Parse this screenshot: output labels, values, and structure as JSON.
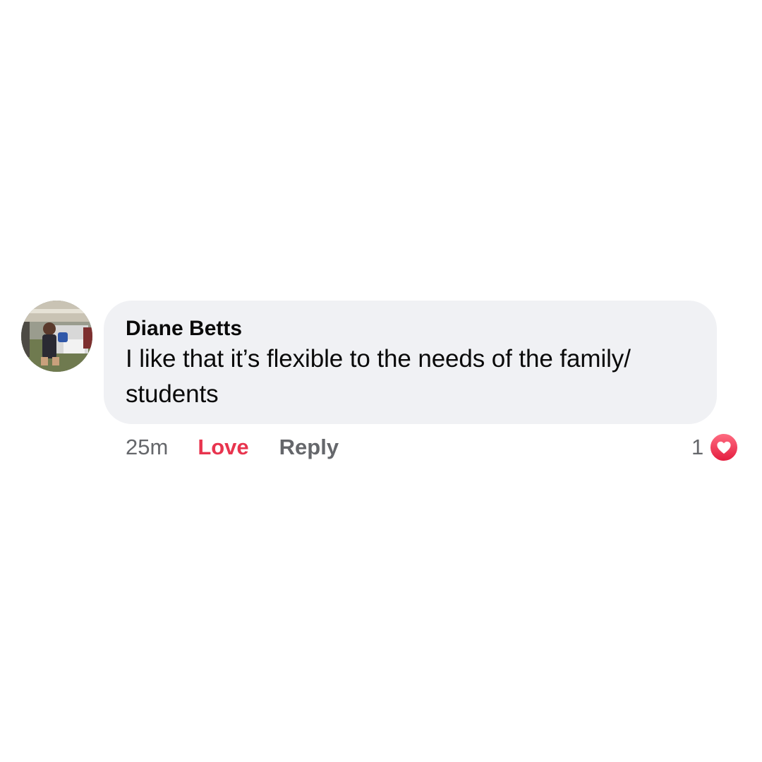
{
  "comment": {
    "author": "Diane Betts",
    "text_line1": "I like that it’s flexible to the needs of the family/",
    "text_line2": "students",
    "timestamp": "25m",
    "love_label": "Love",
    "reply_label": "Reply",
    "reaction_count": "1",
    "reaction_icon": "heart-icon",
    "colors": {
      "bubble_bg": "#f0f1f4",
      "love_accent": "#e8344e",
      "secondary_text": "#65676b"
    }
  }
}
